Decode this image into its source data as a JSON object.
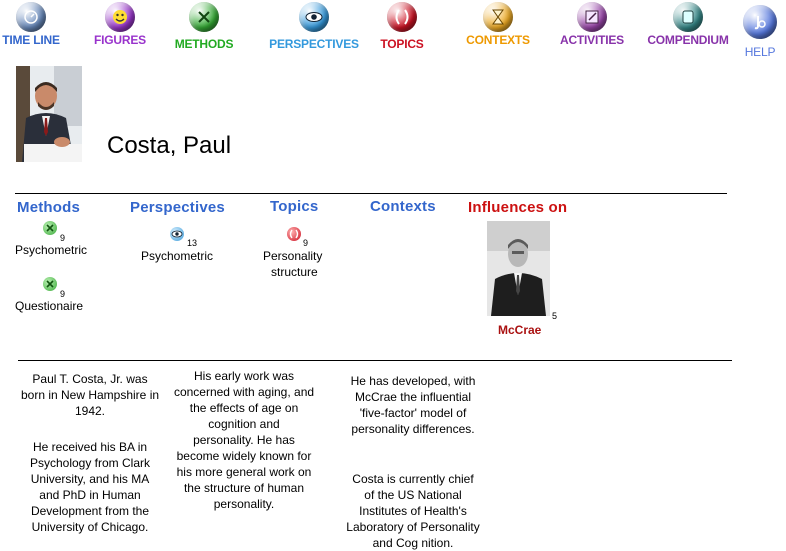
{
  "nav": [
    {
      "label": "TIME LINE",
      "color": "#3366cc",
      "icon": "timeline-icon"
    },
    {
      "label": "FIGURES",
      "color": "#9933cc",
      "icon": "figures-icon"
    },
    {
      "label": "METHODS",
      "color": "#22aa22",
      "icon": "methods-icon"
    },
    {
      "label": "PERSPECTIVES",
      "color": "#3399dd",
      "icon": "perspectives-icon"
    },
    {
      "label": "TOPICS",
      "color": "#cc1122",
      "icon": "topics-icon"
    },
    {
      "label": "CONTEXTS",
      "color": "#ee9900",
      "icon": "contexts-icon"
    },
    {
      "label": "ACTIVITIES",
      "color": "#8833aa",
      "icon": "activities-icon"
    },
    {
      "label": "COMPENDIUM",
      "color": "#8833aa",
      "icon": "compendium-icon"
    },
    {
      "label": "HELP",
      "color": "#5577dd",
      "icon": "help-icon"
    }
  ],
  "person": {
    "name": "Costa, Paul"
  },
  "columns": {
    "methods": {
      "heading": "Methods",
      "color": "#3366cc",
      "items": [
        {
          "label": "Psychometric",
          "count": "9"
        },
        {
          "label": "Questionaire",
          "count": "9"
        }
      ]
    },
    "perspectives": {
      "heading": "Perspectives",
      "color": "#3366cc",
      "items": [
        {
          "label": "Psychometric",
          "count": "13"
        }
      ]
    },
    "topics": {
      "heading": "Topics",
      "color": "#3366cc",
      "items": [
        {
          "label_line1": "Personality",
          "label_line2": "structure",
          "count": "9"
        }
      ]
    },
    "contexts": {
      "heading": "Contexts",
      "color": "#3366cc",
      "items": []
    },
    "influences": {
      "heading": "Influences on",
      "color": "#cc1111",
      "items": [
        {
          "name": "McCrae",
          "count": "5"
        }
      ]
    }
  },
  "bio": {
    "col1": [
      [
        "Paul T. Costa, Jr. was",
        "born in New Hampshire in",
        "1942."
      ],
      [
        "He received his BA in",
        "Psychology from Clark",
        "University, and his MA",
        "and PhD in Human",
        "Development from  the",
        "University of Chicago."
      ]
    ],
    "col2": [
      [
        "His early work was",
        "concerned with aging, and",
        "the effects of age on",
        "cognition and",
        "personality. He has",
        "become widely known for",
        "his more general work on",
        "the structure of human",
        "personality."
      ]
    ],
    "col3": [
      [
        "He has developed, with",
        "McCrae the influential",
        "'five-factor' model of",
        "personality differences."
      ],
      [
        "Costa is currently chief",
        "of the US National",
        "Institutes of Health's",
        "Laboratory of Personality",
        "and Cog nition."
      ]
    ]
  }
}
